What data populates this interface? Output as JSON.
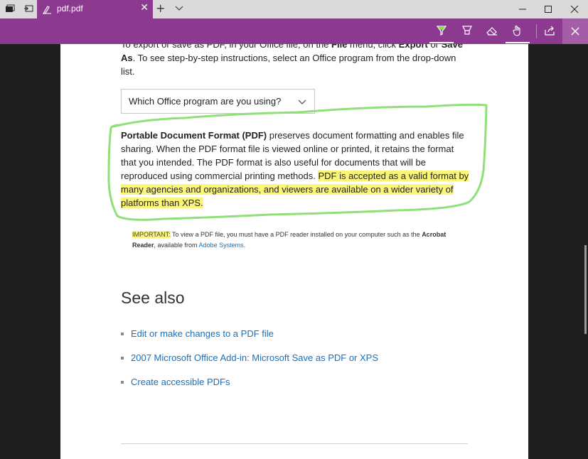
{
  "titlebar": {
    "tab_title": "pdf.pdf",
    "new_tab_glyph": "+",
    "icons": [
      "tab-groups-icon",
      "set-aside-tabs-icon",
      "edge-pen-logo-icon",
      "close-tab-icon",
      "new-tab-icon",
      "tab-list-chevron-icon"
    ],
    "window_controls": [
      "minimize-icon",
      "maximize-icon",
      "close-window-icon"
    ]
  },
  "toolbar": {
    "accent": "#8b3a8f",
    "tools": [
      "ballpoint-pen-icon",
      "highlighter-icon",
      "eraser-icon",
      "touch-writing-icon",
      "share-icon",
      "exit-ink-icon"
    ],
    "active_pen_color": "#7be04a"
  },
  "document": {
    "intro": {
      "part1": "To export or save as PDF, in your Office file, on the ",
      "bold1": "File",
      "part2": " menu, click ",
      "bold2": "Export",
      "part3": " or ",
      "bold3": "Save As",
      "part4": ". To see step-by-step instructions, select an Office program from the drop-down list."
    },
    "dropdown_label": "Which Office program are you using?",
    "pdf_heading": "Portable Document Format (PDF)",
    "pdf_body": " preserves document formatting and enables file sharing. When the PDF format file is viewed online or printed, it retains the format that you intended. The PDF format is also useful for documents that will be reproduced using commercial printing methods. ",
    "pdf_highlight": "PDF is accepted as a valid format by many agencies and organizations, and viewers are available on a wider variety of platforms than XPS.",
    "important_label": "IMPORTANT:",
    "important_text": " To view a PDF file, you must have a PDF reader installed on your computer such as the ",
    "important_bold": "Acrobat Reader",
    "important_tail": ", available from ",
    "important_link": "Adobe Systems",
    "important_end": ".",
    "see_also_heading": "See also",
    "links": [
      "Edit or make changes to a PDF file",
      "2007 Microsoft Office Add-in: Microsoft Save as PDF or XPS",
      "Create accessible PDFs"
    ],
    "highlight_color": "#fbf67a",
    "ink_color": "#90e07a"
  }
}
